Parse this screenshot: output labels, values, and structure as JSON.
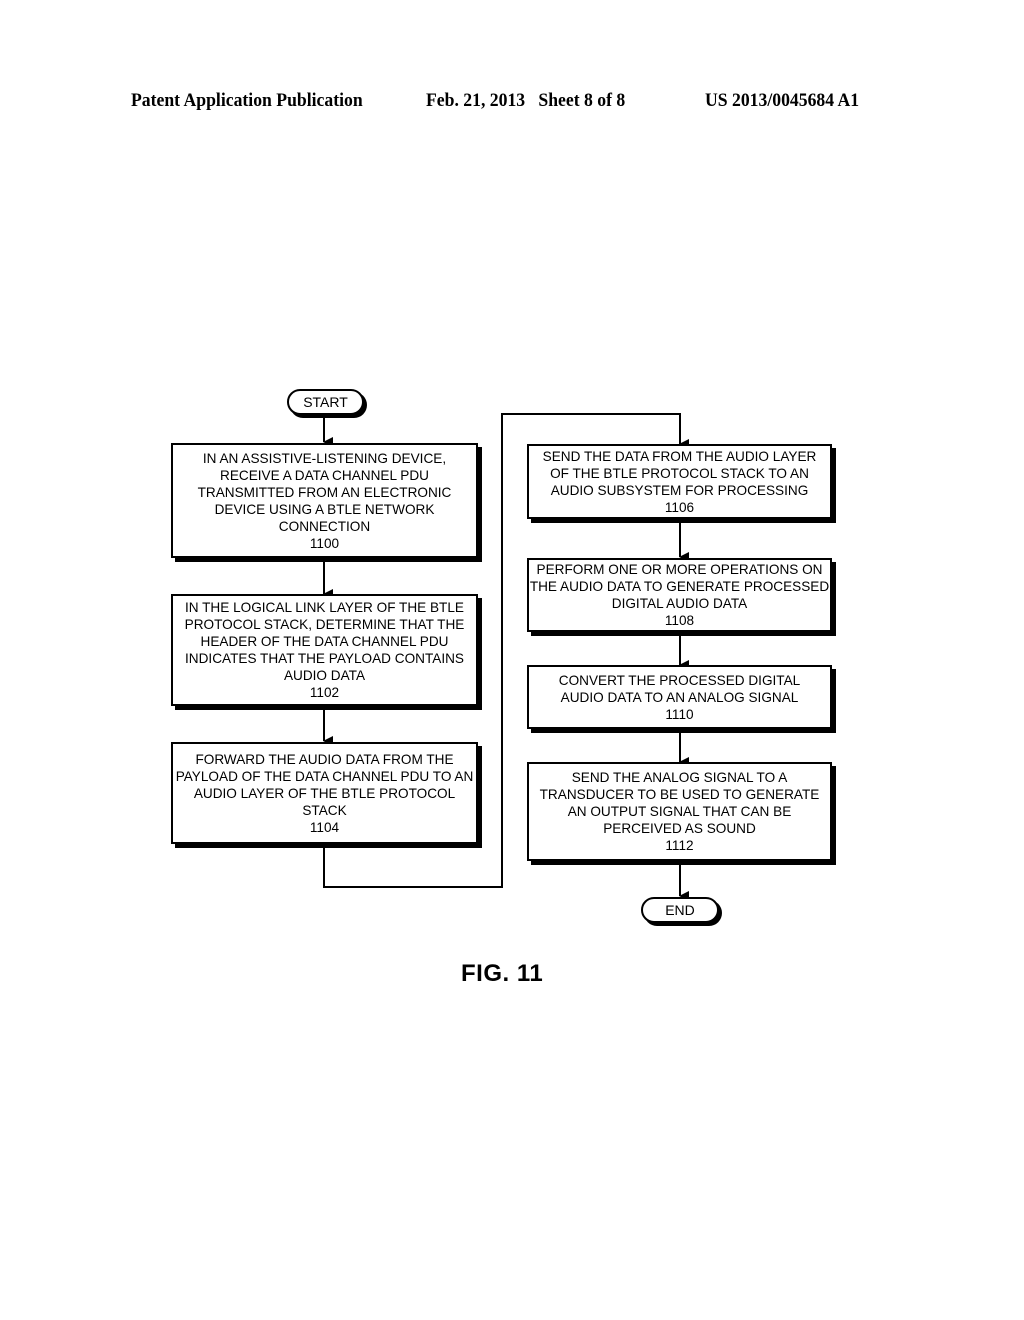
{
  "header": {
    "publication": "Patent Application Publication",
    "date_sheet": "Feb. 21, 2013   Sheet 8 of 8",
    "patent_number": "US 2013/0045684 A1"
  },
  "flowchart": {
    "start": "START",
    "end": "END",
    "steps": [
      {
        "text": "IN AN ASSISTIVE-LISTENING DEVICE, RECEIVE A DATA CHANNEL PDU TRANSMITTED FROM AN ELECTRONIC DEVICE USING A BTLE NETWORK CONNECTION",
        "ref": "1100"
      },
      {
        "text": "IN THE LOGICAL LINK LAYER OF THE BTLE PROTOCOL STACK, DETERMINE THAT THE HEADER OF THE DATA CHANNEL PDU INDICATES THAT THE PAYLOAD CONTAINS AUDIO DATA",
        "ref": "1102"
      },
      {
        "text": "FORWARD THE AUDIO DATA FROM THE PAYLOAD OF THE DATA CHANNEL PDU TO AN AUDIO LAYER OF THE BTLE PROTOCOL STACK",
        "ref": "1104"
      },
      {
        "text": "SEND THE DATA FROM THE AUDIO LAYER OF THE BTLE PROTOCOL STACK TO AN AUDIO SUBSYSTEM FOR PROCESSING",
        "ref": "1106"
      },
      {
        "text": "PERFORM ONE OR MORE OPERATIONS ON THE AUDIO DATA TO GENERATE PROCESSED DIGITAL AUDIO DATA",
        "ref": "1108"
      },
      {
        "text": "CONVERT THE PROCESSED DIGITAL AUDIO DATA TO AN ANALOG SIGNAL",
        "ref": "1110"
      },
      {
        "text": "SEND THE ANALOG SIGNAL TO A TRANSDUCER TO BE USED TO GENERATE AN OUTPUT SIGNAL THAT CAN BE PERCEIVED AS SOUND",
        "ref": "1112"
      }
    ]
  },
  "figure_label": "FIG. 11"
}
